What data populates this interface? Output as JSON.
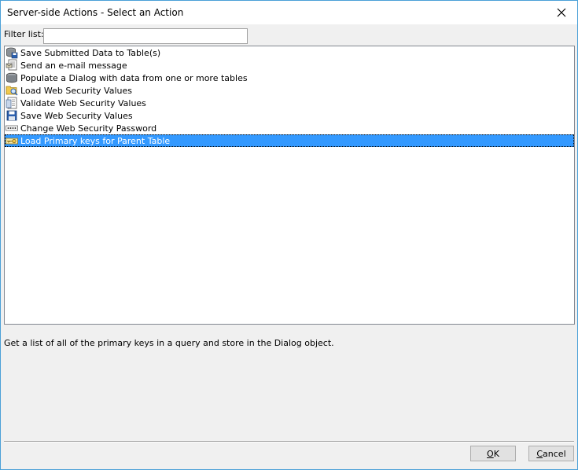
{
  "window": {
    "title": "Server-side Actions - Select an Action"
  },
  "filter": {
    "label": "Filter list:",
    "value": ""
  },
  "actions": [
    {
      "label": "Save Submitted Data to Table(s)",
      "icon": "database-save-icon"
    },
    {
      "label": "Send an e-mail message",
      "icon": "email-document-icon"
    },
    {
      "label": "Populate a Dialog with data from one or more tables",
      "icon": "database-icon"
    },
    {
      "label": "Load Web Security Values",
      "icon": "folder-magnifier-icon"
    },
    {
      "label": "Validate Web Security Values",
      "icon": "document-list-icon"
    },
    {
      "label": "Save Web Security Values",
      "icon": "floppy-disk-icon"
    },
    {
      "label": "Change Web Security Password",
      "icon": "password-field-icon"
    },
    {
      "label": "Load Primary keys for Parent Table",
      "icon": "key-table-icon",
      "selected": true
    }
  ],
  "description": "Get a list of all of the primary keys in a query and store in the Dialog object.",
  "buttons": {
    "ok": {
      "underline": "O",
      "rest": "K"
    },
    "cancel": {
      "underline": "C",
      "rest": "ancel"
    }
  },
  "colors": {
    "selection": "#3399ff",
    "window_border": "#4aa0d8"
  }
}
